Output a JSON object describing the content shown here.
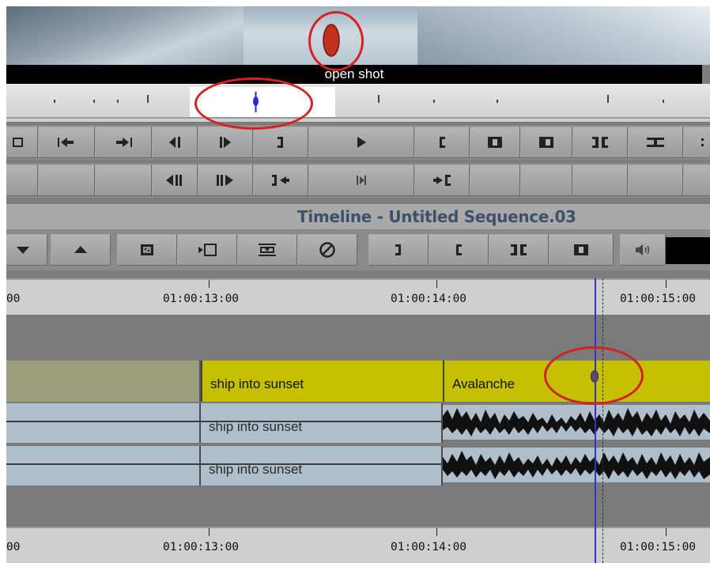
{
  "source_monitor": {
    "clip_name": "open shot"
  },
  "timeline": {
    "title": "Timeline - Untitled Sequence.03",
    "ruler_top": [
      "00",
      "01:00:13:00",
      "01:00:14:00",
      "01:00:15:00"
    ],
    "ruler_bottom": [
      "00",
      "01:00:13:00",
      "01:00:14:00",
      "01:00:15:00"
    ],
    "tracks": {
      "v1": {
        "clips": [
          "ship into sunset",
          "Avalanche"
        ]
      },
      "a1": {
        "clips": [
          "ship into sunset"
        ]
      },
      "a2": {
        "clips": [
          "ship into sunset"
        ]
      }
    }
  },
  "colors": {
    "annotation": "#d42121",
    "playhead": "#3333cc",
    "video_clip": "#c4bf00",
    "audio_clip": "#aebfcb",
    "filler_clip": "#9b9d7c",
    "title_text": "#3f5169"
  },
  "icons": {
    "row1": [
      "stop-icon",
      "go-to-in-icon",
      "go-to-out-icon",
      "step-back-icon",
      "step-forward-icon",
      "mark-out-icon",
      "play-icon",
      "mark-in-icon",
      "mark-clip-icon",
      "clear-mark-icon",
      "match-frame-icon",
      "add-edit-icon"
    ],
    "row2": [
      "step-back-many-icon",
      "step-forward-many-icon",
      "go-to-previous-edit-icon",
      "play-in-to-out-icon",
      "go-to-next-edit-icon"
    ],
    "timeline_toolbar": [
      "extract-icon",
      "lift-icon",
      "overwrite-icon",
      "splice-icon",
      "lift-overwrite-icon",
      "clear-icon",
      "mark-out-icon",
      "mark-in-icon",
      "mark-clip-icon",
      "match-frame-icon",
      "speaker-icon"
    ]
  }
}
